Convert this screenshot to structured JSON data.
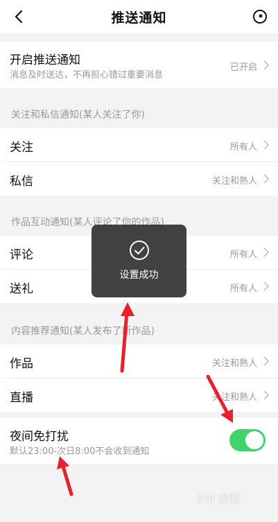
{
  "header": {
    "title": "推送通知",
    "back_icon": "chevron-left-icon",
    "more_icon": "circle-dot-icon"
  },
  "push": {
    "label": "开启推送通知",
    "sub": "消息及时送达，不再担心错过重要消息",
    "value": "已开启"
  },
  "section_follow": {
    "title": "关注和私信通知(某人关注了你)",
    "items": [
      {
        "label": "关注",
        "value": "所有人"
      },
      {
        "label": "私信",
        "value": "关注和熟人"
      }
    ]
  },
  "section_interact": {
    "title": "作品互动通知(某人评论了你的作品)",
    "items": [
      {
        "label": "评论",
        "value": "所有人"
      },
      {
        "label": "送礼",
        "value": "所有人"
      }
    ]
  },
  "section_recommend": {
    "title": "内容推荐通知(某人发布了新作品)",
    "items": [
      {
        "label": "作品",
        "value": "关注和熟人"
      },
      {
        "label": "直播",
        "value": "关注和熟人"
      }
    ]
  },
  "night": {
    "label": "夜间免打扰",
    "sub": "默认23:00-次日8:00不会收到通知",
    "enabled": true
  },
  "toast": {
    "text": "设置成功",
    "icon": "check-circle-icon"
  },
  "watermark": {
    "text": "Bai 经验"
  },
  "colors": {
    "toggle_on": "#3fd46a",
    "annotation_arrow": "#e8202a"
  }
}
